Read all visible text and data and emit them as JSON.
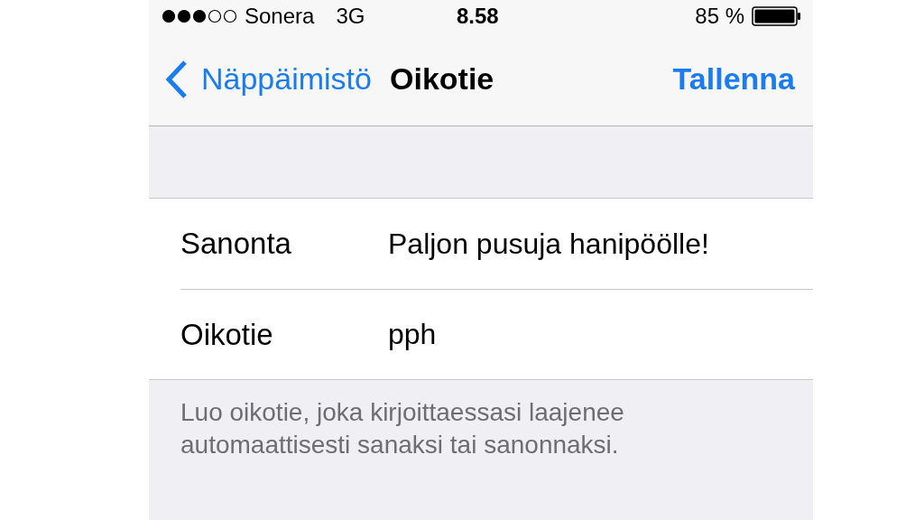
{
  "status_bar": {
    "carrier": "Sonera",
    "network": "3G",
    "time": "8.58",
    "battery": "85 %"
  },
  "nav_bar": {
    "back": "Näppäimistö",
    "title": "Oikotie",
    "action": "Tallenna"
  },
  "form": {
    "rows": [
      {
        "label": "Sanonta",
        "value": "Paljon pusuja hanipöölle!"
      },
      {
        "label": "Oikotie",
        "value": "pph"
      }
    ],
    "footer": "Luo oikotie, joka kirjoittaessasi laajenee automaattisesti sanaksi tai sanonnaksi."
  }
}
